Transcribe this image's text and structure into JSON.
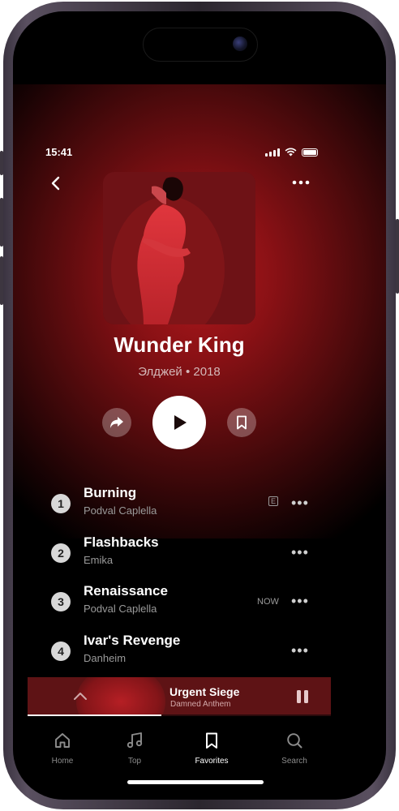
{
  "status_bar": {
    "time": "15:41"
  },
  "album": {
    "title": "Wunder King",
    "subtitle": "Элджей • 2018"
  },
  "tracks": [
    {
      "number": "1",
      "title": "Burning",
      "artist": "Podval Caplella",
      "explicit_badge": "E"
    },
    {
      "number": "2",
      "title": "Flashbacks",
      "artist": "Emika"
    },
    {
      "number": "3",
      "title": "Renaissance",
      "artist": "Podval Caplella",
      "status": "NOW"
    },
    {
      "number": "4",
      "title": "Ivar's Revenge",
      "artist": "Danheim"
    }
  ],
  "mini_player": {
    "title": "Urgent Siege",
    "artist": "Damned Anthem",
    "progress_fraction": 0.44
  },
  "tab_bar": {
    "tabs": [
      {
        "label": "Home",
        "icon": "home-icon"
      },
      {
        "label": "Top",
        "icon": "music-note-icon"
      },
      {
        "label": "Favorites",
        "icon": "bookmark-icon",
        "active": true
      },
      {
        "label": "Search",
        "icon": "search-icon"
      }
    ]
  },
  "colors": {
    "accent_red": "#b0181c",
    "mini_player_bg": "#5e1315",
    "active_tab": "#ffffff",
    "inactive_tab": "#8c8c8c"
  }
}
